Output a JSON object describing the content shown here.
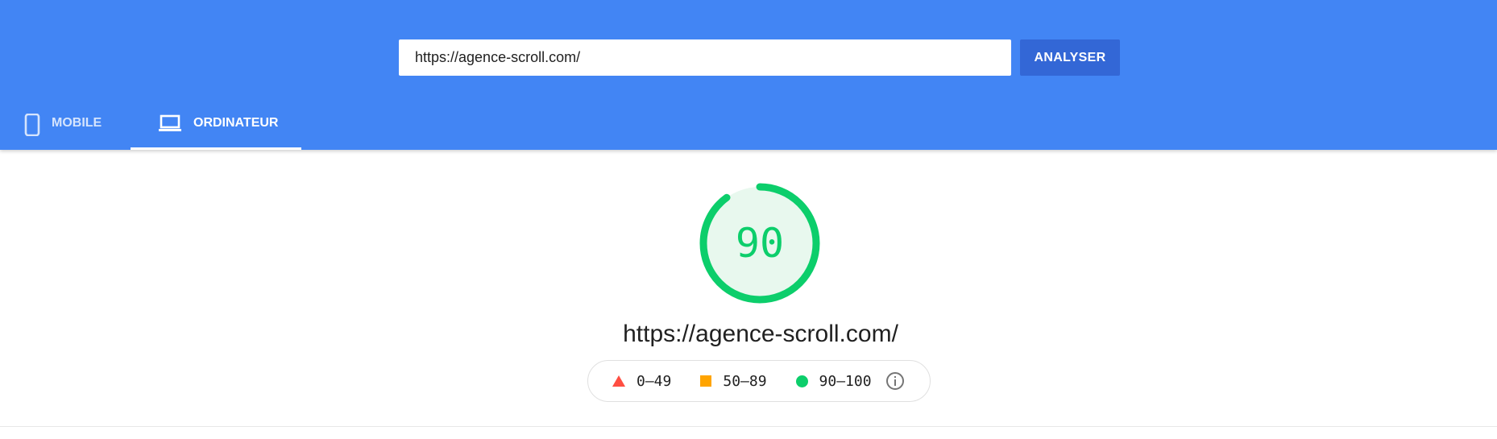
{
  "search": {
    "url_value": "https://agence-scroll.com/",
    "analyze_label": "ANALYSER"
  },
  "tabs": [
    {
      "label": "MOBILE",
      "icon": "smartphone-icon",
      "selected": false
    },
    {
      "label": "ORDINATEUR",
      "icon": "laptop-icon",
      "selected": true
    }
  ],
  "report": {
    "score": "90",
    "score_fraction": 0.9,
    "url": "https://agence-scroll.com/"
  },
  "legend": [
    {
      "range": "0–49",
      "shape": "triangle",
      "color": "#ff4e42"
    },
    {
      "range": "50–89",
      "shape": "square",
      "color": "#ffa400"
    },
    {
      "range": "90–100",
      "shape": "circle",
      "color": "#0cce6b"
    }
  ],
  "colors": {
    "header_blue": "#4285f4",
    "button_blue": "#3367d6",
    "pass_green": "#0cce6b",
    "gauge_fill": "#e8f8ee"
  }
}
